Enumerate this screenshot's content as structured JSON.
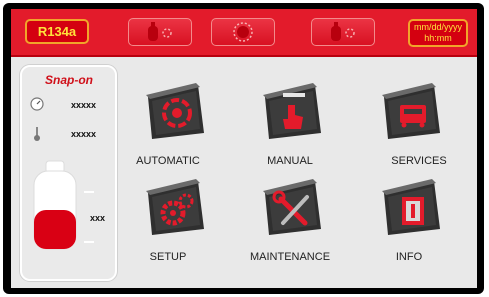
{
  "header": {
    "refrigerant": "R134a",
    "date_format": "mm/dd/yyyy",
    "time_format": "hh:mm",
    "mode_buttons": [
      {
        "icon": "tank-recover-icon"
      },
      {
        "icon": "gear-cycle-icon"
      },
      {
        "icon": "tank-charge-icon"
      }
    ]
  },
  "status": {
    "brand": "Snap-on",
    "pressure_value": "xxxxx",
    "temperature_value": "xxxxx",
    "tank_value": "xxx",
    "tank_fill_fraction": 0.5
  },
  "menu": {
    "tiles": [
      {
        "label": "AUTOMATIC",
        "icon": "recycle-arrows-icon"
      },
      {
        "label": "MANUAL",
        "icon": "hand-pointer-icon"
      },
      {
        "label": "SERVICES",
        "icon": "service-machine-icon"
      },
      {
        "label": "SETUP",
        "icon": "gears-icon"
      },
      {
        "label": "MAINTENANCE",
        "icon": "wrench-screwdriver-icon"
      },
      {
        "label": "INFO",
        "icon": "info-book-icon"
      }
    ]
  },
  "colors": {
    "topbar": "#e31b2b",
    "accent_yellow": "#ffe23b",
    "tile_dark": "#3a3a3a",
    "tile_red": "#e31b2b"
  }
}
